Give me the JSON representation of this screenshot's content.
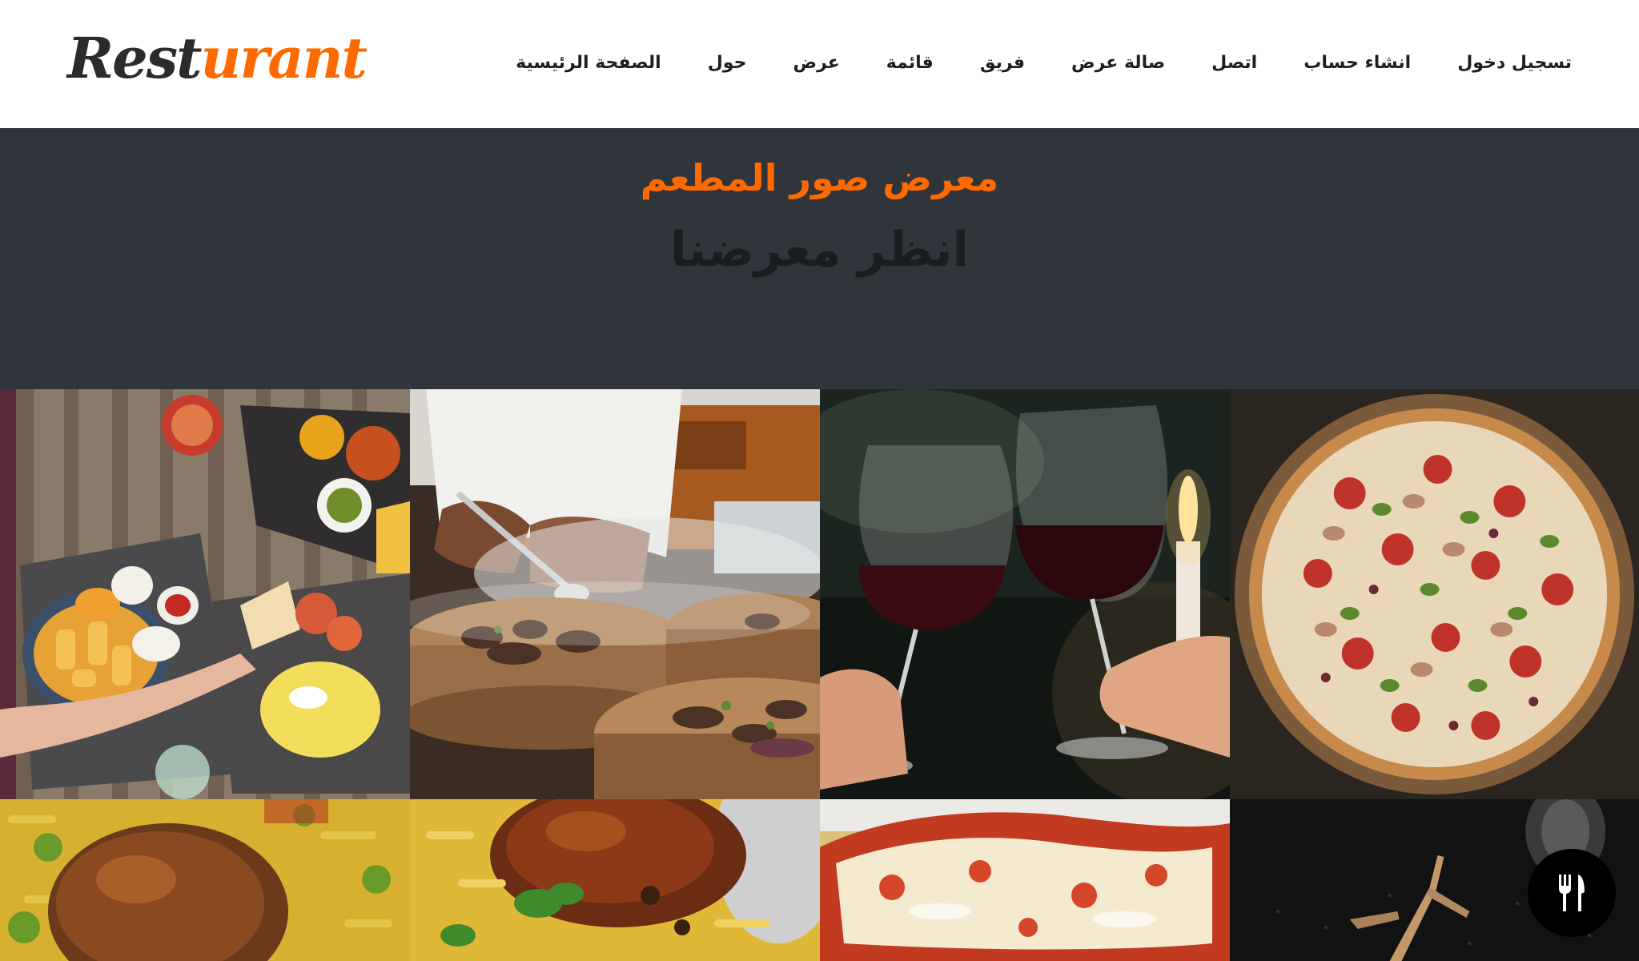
{
  "brand": {
    "logo_part1": "Rest",
    "logo_part2": "urant",
    "accent_color": "#ff6a00",
    "dark_color": "#30343b"
  },
  "nav": {
    "items": [
      {
        "label": "تسجيل دخول"
      },
      {
        "label": "انشاء حساب"
      },
      {
        "label": "اتصل"
      },
      {
        "label": "صالة عرض"
      },
      {
        "label": "فريق"
      },
      {
        "label": "قائمة"
      },
      {
        "label": "عرض"
      },
      {
        "label": "حول"
      },
      {
        "label": "الصفحة الرئيسية"
      }
    ]
  },
  "hero": {
    "subtitle": "معرض صور المطعم",
    "title": "انظر معرضنا"
  },
  "gallery": {
    "photos": [
      {
        "subject": "table-spread"
      },
      {
        "subject": "chef-plating"
      },
      {
        "subject": "wine-toast"
      },
      {
        "subject": "pizza"
      },
      {
        "subject": "chicken-rice"
      },
      {
        "subject": "chicken-rice-2"
      },
      {
        "subject": "lasagna"
      },
      {
        "subject": "dark-plate"
      }
    ]
  },
  "fab": {
    "icon": "utensils-icon"
  }
}
